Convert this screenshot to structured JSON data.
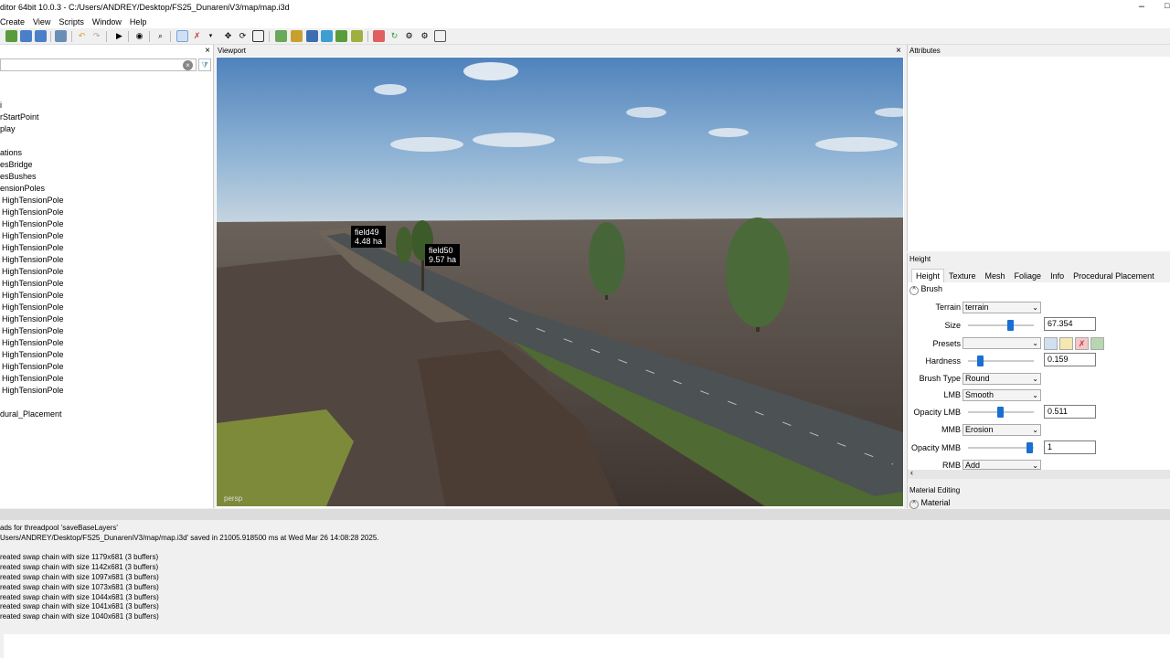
{
  "titlebar": {
    "title": "ditor 64bit 10.0.3 - C:/Users/ANDREY/Desktop/FS25_DunareniV3/map/map.i3d",
    "min": "–",
    "max": "□"
  },
  "menu": [
    "Create",
    "View",
    "Scripts",
    "Window",
    "Help"
  ],
  "scenegraph": {
    "close": "×",
    "items": [
      "i",
      "rStartPoint",
      "play",
      "",
      "ations",
      "esBridge",
      "esBushes",
      "ensionPoles",
      "HighTensionPole",
      "HighTensionPole",
      "HighTensionPole",
      "HighTensionPole",
      "HighTensionPole",
      "HighTensionPole",
      "HighTensionPole",
      "HighTensionPole",
      "HighTensionPole",
      "HighTensionPole",
      "HighTensionPole",
      "HighTensionPole",
      "HighTensionPole",
      "HighTensionPole",
      "HighTensionPole",
      "HighTensionPole",
      "HighTensionPole",
      "",
      "dural_Placement"
    ]
  },
  "viewport": {
    "title": "Viewport",
    "close": "×",
    "camera": "persp",
    "fields": [
      {
        "name": "field49",
        "area": "4.48 ha"
      },
      {
        "name": "field50",
        "area": "9.57 ha"
      }
    ]
  },
  "attributes": {
    "title": "Attributes"
  },
  "height": {
    "title": "Height",
    "tabs": [
      "Height",
      "Texture",
      "Mesh",
      "Foliage",
      "Info",
      "Procedural Placement"
    ],
    "brush_section": "Brush",
    "terrain_label": "Terrain",
    "terrain_value": "terrain",
    "size_label": "Size",
    "size_value": "67.354",
    "size_level": 0.65,
    "presets_label": "Presets",
    "presets_value": "",
    "hardness_label": "Hardness",
    "hardness_value": "0.159",
    "hardness_level": 0.159,
    "brush_type_label": "Brush Type",
    "brush_type_value": "Round",
    "lmb_label": "LMB",
    "lmb_value": "Smooth",
    "opacity_lmb_label": "Opacity LMB",
    "opacity_lmb_value": "0.511",
    "opacity_lmb_level": 0.511,
    "mmb_label": "MMB",
    "mmb_value": "Erosion",
    "opacity_mmb_label": "Opacity MMB",
    "opacity_mmb_value": "1",
    "opacity_mmb_level": 1,
    "rmb_label": "RMB",
    "rmb_value": "Add"
  },
  "material_editing": {
    "title": "Material Editing",
    "section": "Material"
  },
  "log": [
    "ads for threadpool 'saveBaseLayers'",
    "Users/ANDREY/Desktop/FS25_DunareniV3/map/map.i3d' saved in 21005.918500 ms at Wed Mar 26 14:08:28 2025.",
    "",
    "reated swap chain with size 1179x681 (3 buffers)",
    "reated swap chain with size 1142x681 (3 buffers)",
    "reated swap chain with size 1097x681 (3 buffers)",
    "reated swap chain with size 1073x681 (3 buffers)",
    "reated swap chain with size 1044x681 (3 buffers)",
    "reated swap chain with size 1041x681 (3 buffers)",
    "reated swap chain with size 1040x681 (3 buffers)"
  ],
  "colors": {
    "accent": "#1a6fd1",
    "sky_top": "#5f8fc0",
    "terrain": "#5a5048"
  }
}
